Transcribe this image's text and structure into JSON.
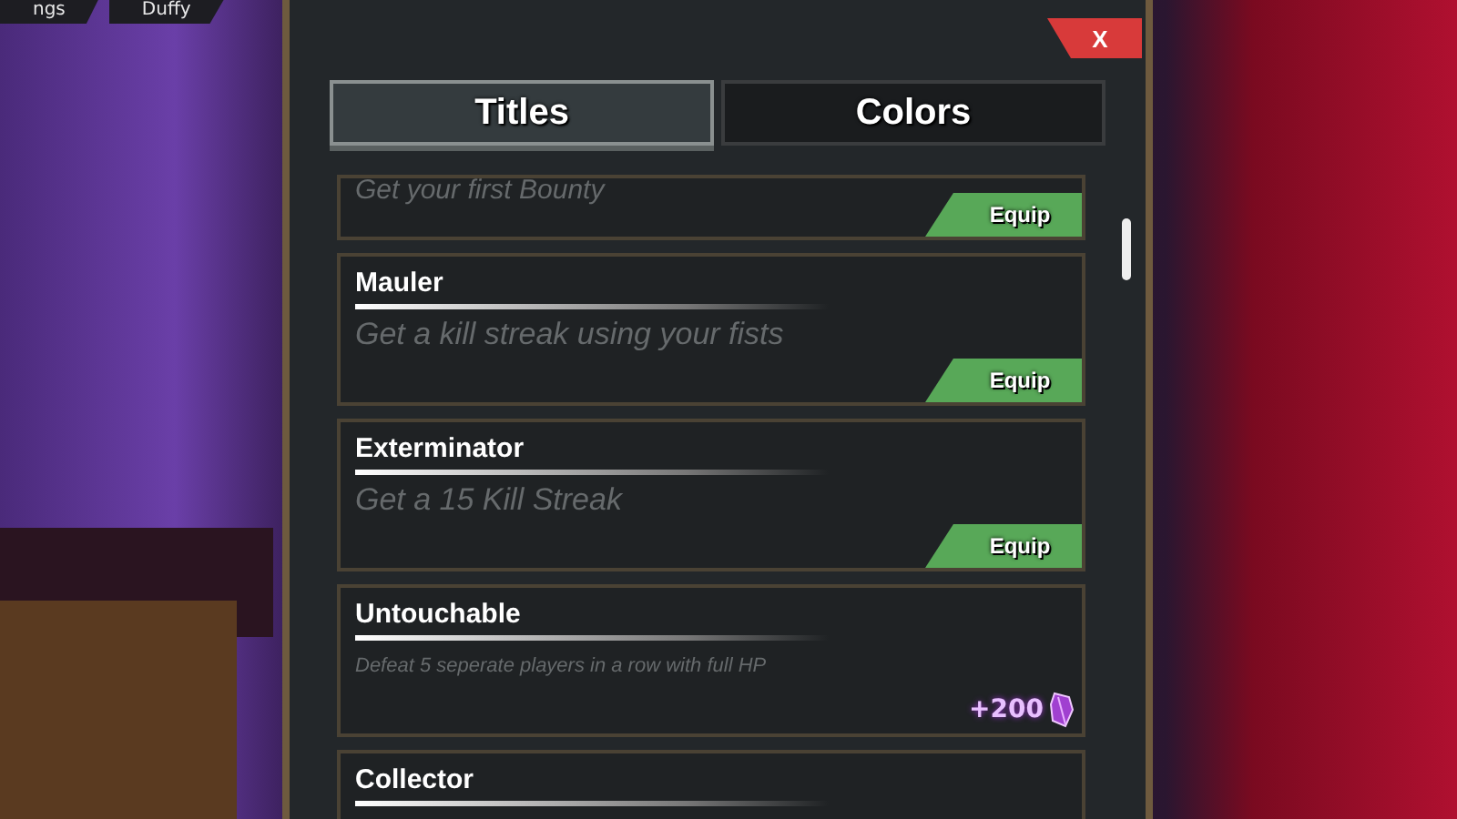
{
  "hud_tags": [
    {
      "label": "ngs"
    },
    {
      "label": "Duffy"
    }
  ],
  "panel": {
    "close": "X",
    "tabs": [
      {
        "label": "Titles",
        "selected": true
      },
      {
        "label": "Colors",
        "selected": false
      }
    ],
    "titles": [
      {
        "kind": "equip",
        "description": "Get your first Bounty",
        "action": "Equip"
      },
      {
        "kind": "equip",
        "name": "Mauler",
        "description": "Get a kill streak using your fists",
        "action": "Equip"
      },
      {
        "kind": "equip",
        "name": "Exterminator",
        "description": "Get a 15 Kill Streak",
        "action": "Equip"
      },
      {
        "kind": "reward",
        "name": "Untouchable",
        "description": "Defeat 5 seperate players in a row with full HP",
        "reward": "+200"
      },
      {
        "kind": "reward",
        "name": "Collector"
      }
    ]
  }
}
